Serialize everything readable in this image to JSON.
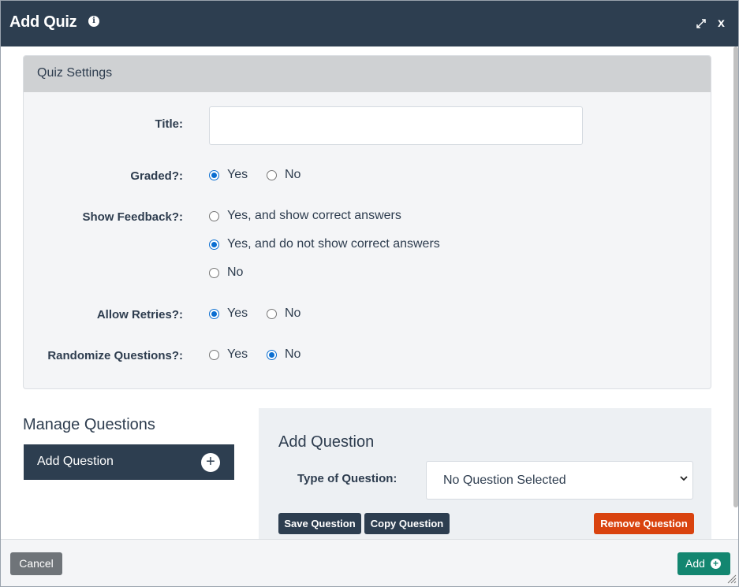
{
  "titlebar": {
    "title": "Add Quiz",
    "info_icon": "info-icon",
    "expand_icon": "expand-icon",
    "close_label": "x"
  },
  "quiz_settings": {
    "header": "Quiz Settings",
    "title_label": "Title:",
    "title_value": "",
    "graded": {
      "label": "Graded?:",
      "options": [
        "Yes",
        "No"
      ],
      "selected": "Yes"
    },
    "show_feedback": {
      "label": "Show Feedback?:",
      "options": [
        "Yes, and show correct answers",
        "Yes, and do not show correct answers",
        "No"
      ],
      "selected": "Yes, and do not show correct answers"
    },
    "allow_retries": {
      "label": "Allow Retries?:",
      "options": [
        "Yes",
        "No"
      ],
      "selected": "Yes"
    },
    "randomize_questions": {
      "label": "Randomize Questions?:",
      "options": [
        "Yes",
        "No"
      ],
      "selected": "No"
    }
  },
  "manage_questions": {
    "title": "Manage Questions",
    "add_button": "Add Question",
    "add_icon": "+"
  },
  "add_question_panel": {
    "heading": "Add Question",
    "type_label": "Type of Question:",
    "type_selected": "No Question Selected",
    "save_button": "Save Question",
    "copy_button": "Copy Question",
    "remove_button": "Remove Question"
  },
  "footer": {
    "cancel_button": "Cancel",
    "add_button": "Add"
  },
  "colors": {
    "titlebar": "#2d3e50",
    "radio_accent": "#0a6ed1",
    "remove_button": "#d9430f",
    "add_button": "#138670",
    "cancel_button": "#6f7479"
  }
}
